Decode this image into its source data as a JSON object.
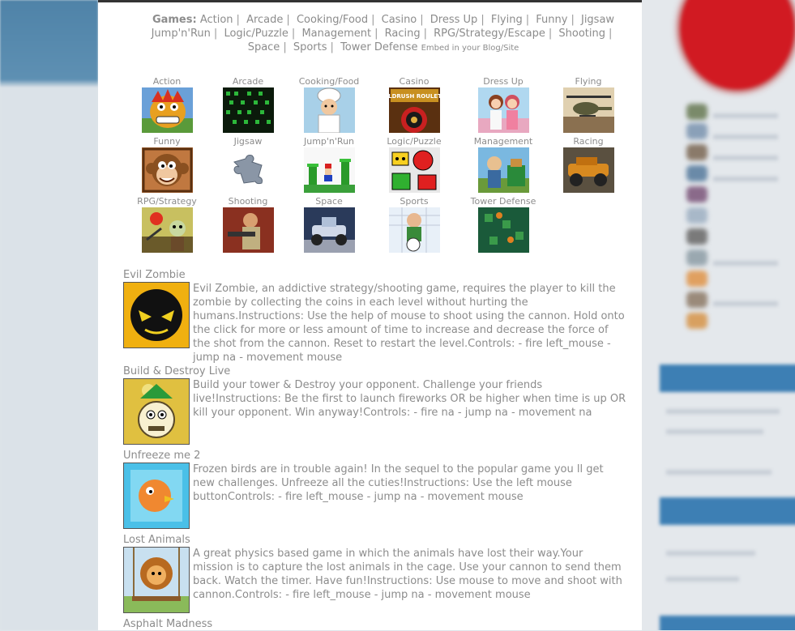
{
  "nav": {
    "heading": "Games:",
    "categories": [
      "Action",
      "Arcade",
      "Cooking/Food",
      "Casino",
      "Dress Up",
      "Flying",
      "Funny",
      "Jigsaw",
      "Jump'n'Run",
      "Logic/Puzzle",
      "Management",
      "Racing",
      "RPG/Strategy/Escape",
      "Shooting",
      "Space",
      "Sports",
      "Tower Defense"
    ],
    "separator": "|",
    "embed": "Embed in your Blog/Site"
  },
  "tiles": [
    {
      "label": "Action",
      "icon": "dragon-icon"
    },
    {
      "label": "Arcade",
      "icon": "arcade-grid-icon"
    },
    {
      "label": "Cooking/Food",
      "icon": "chef-icon"
    },
    {
      "label": "Casino",
      "icon": "roulette-icon",
      "art_text": "GOLDRUSH ROULETTE"
    },
    {
      "label": "Dress Up",
      "icon": "couple-icon"
    },
    {
      "label": "Flying",
      "icon": "helicopter-icon"
    },
    {
      "label": "Funny",
      "icon": "monkey-icon"
    },
    {
      "label": "Jigsaw",
      "icon": "puzzle-piece-icon"
    },
    {
      "label": "Jump'n'Run",
      "icon": "mario-icon"
    },
    {
      "label": "Logic/Puzzle",
      "icon": "puzzle-blocks-icon"
    },
    {
      "label": "Management",
      "icon": "farmer-icon"
    },
    {
      "label": "Racing",
      "icon": "truck-icon"
    },
    {
      "label": "RPG/Strategy",
      "icon": "zombie-icon"
    },
    {
      "label": "Shooting",
      "icon": "gunman-icon"
    },
    {
      "label": "Space",
      "icon": "moon-rover-icon"
    },
    {
      "label": "Sports",
      "icon": "soccer-player-icon"
    },
    {
      "label": "Tower Defense",
      "icon": "tower-defense-icon"
    }
  ],
  "games": [
    {
      "title": "Evil Zombie",
      "icon": "evil-zombie-icon",
      "description": "Evil Zombie, an addictive strategy/shooting game, requires the player to kill the zombie by collecting the coins in each level without hurting the humans.Instructions: Use the help of mouse to shoot using the cannon. Hold onto the click for more or less amount of time to increase and decrease the force of the shot from the cannon. Reset to restart the level.Controls: - fire left_mouse - jump na - movement mouse"
    },
    {
      "title": "Build & Destroy Live",
      "icon": "build-destroy-icon",
      "description": "Build your tower & Destroy your opponent. Challenge your friends live!Instructions: Be the first to launch fireworks OR be higher when time is up OR kill your opponent. Win anyway!Controls: - fire na - jump na - movement na"
    },
    {
      "title": "Unfreeze me 2",
      "icon": "frozen-bird-icon",
      "description": "Frozen birds are in trouble again! In the sequel to the popular game you ll get new challenges. Unfreeze all the cuties!Instructions: Use the left mouse buttonControls: - fire left_mouse - jump na - movement mouse"
    },
    {
      "title": "Lost Animals",
      "icon": "lion-icon",
      "description": "A great physics based game in which the animals have lost their way.Your mission is to capture the lost animals in the cage. Use your cannon to send them back. Watch the timer. Have fun!Instructions: Use mouse to move and shoot with cannon.Controls: - fire left_mouse - jump na - movement mouse"
    },
    {
      "title": "Asphalt Madness"
    }
  ]
}
